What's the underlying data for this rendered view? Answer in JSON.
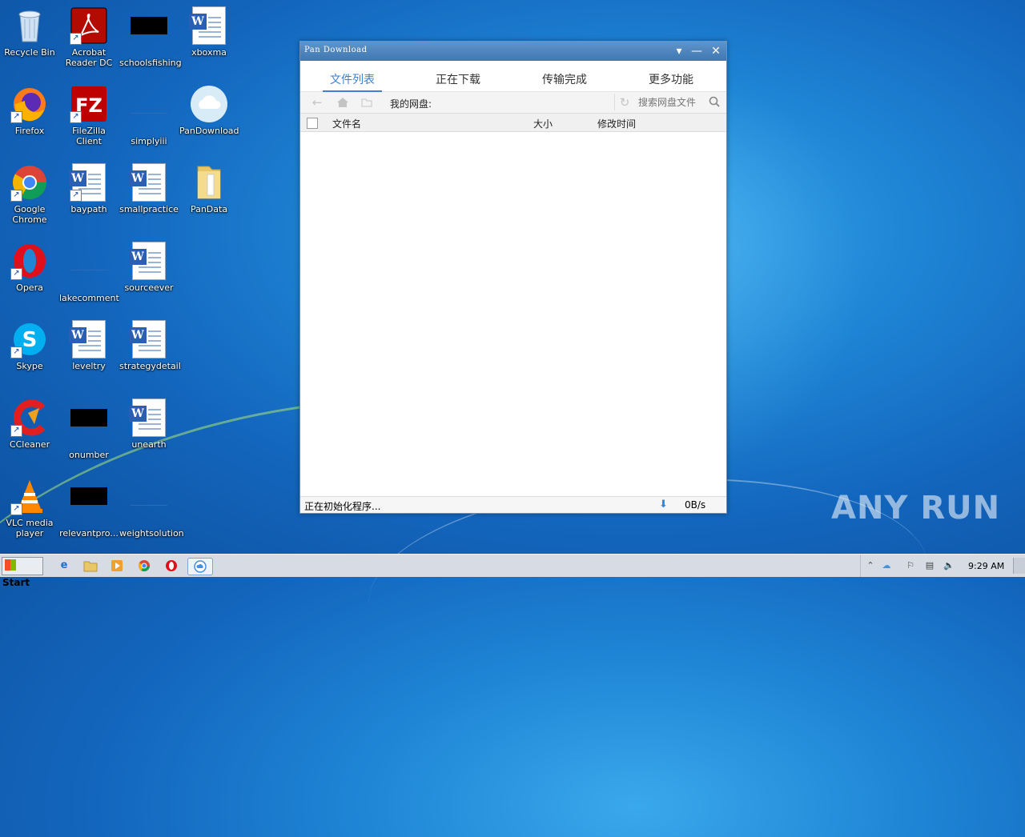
{
  "desktop": {
    "icons": [
      {
        "label": "Recycle Bin"
      },
      {
        "label": "Acrobat Reader DC"
      },
      {
        "label": "schoolsfishing"
      },
      {
        "label": "xboxma"
      },
      {
        "label": "Firefox"
      },
      {
        "label": "FileZilla Client"
      },
      {
        "label": "simplyiii"
      },
      {
        "label": "PanDownload"
      },
      {
        "label": "Google Chrome"
      },
      {
        "label": "baypath"
      },
      {
        "label": "smallpractice"
      },
      {
        "label": "PanData"
      },
      {
        "label": "Opera"
      },
      {
        "label": "lakecomment"
      },
      {
        "label": "sourceever"
      },
      {
        "label": "Skype"
      },
      {
        "label": "leveltry"
      },
      {
        "label": "strategydetail"
      },
      {
        "label": "CCleaner"
      },
      {
        "label": "onumber"
      },
      {
        "label": "unearth"
      },
      {
        "label": "VLC media player"
      },
      {
        "label": "relevantpro..."
      },
      {
        "label": "weightsolution"
      }
    ]
  },
  "window": {
    "title": "Pan Download",
    "tabs": [
      {
        "label": "文件列表",
        "active": true
      },
      {
        "label": "正在下载"
      },
      {
        "label": "传输完成"
      },
      {
        "label": "更多功能"
      }
    ],
    "path_label": "我的网盘:",
    "search_placeholder": "搜索网盘文件",
    "columns": {
      "name": "文件名",
      "size": "大小",
      "modified": "修改时间"
    },
    "status_text": "正在初始化程序...",
    "speed": "0B/s"
  },
  "taskbar": {
    "start_label": "Start",
    "clock": "9:29 AM"
  },
  "watermark": "ANY RUN",
  "colors": {
    "accent": "#3d7fd0",
    "titlebar": "#4a82bd",
    "taskbar": "#d6dbe4"
  }
}
